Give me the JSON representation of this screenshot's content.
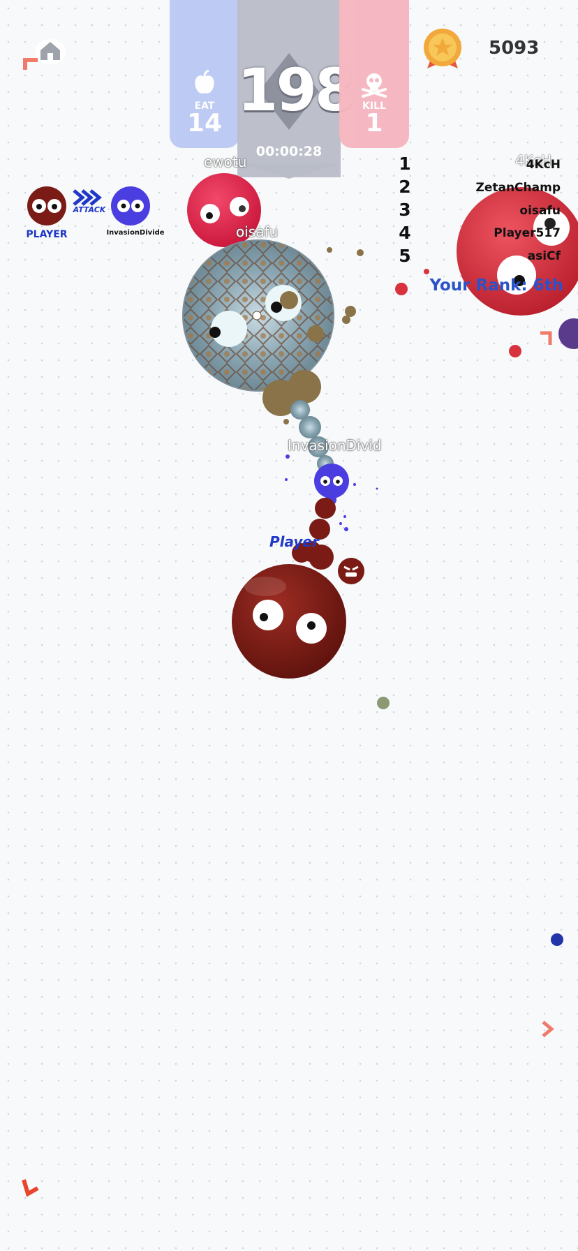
{
  "hud": {
    "eat_label": "EAT",
    "eat_count": "14",
    "score": "198",
    "timer": "00:00:28",
    "kill_label": "KILL",
    "kill_count": "1"
  },
  "coins": {
    "amount": "5093",
    "icon": "gold-medal-icon"
  },
  "home_button": {
    "icon": "home-icon"
  },
  "attack_indicator": {
    "attacker": "PLAYER",
    "action": "ATTACK",
    "target": "InvasionDivide"
  },
  "leaderboard": {
    "entries": [
      {
        "rank": "1",
        "name": "4KcH"
      },
      {
        "rank": "2",
        "name": "ZetanChamp"
      },
      {
        "rank": "3",
        "name": "oisafu"
      },
      {
        "rank": "4",
        "name": "Player517"
      },
      {
        "rank": "5",
        "name": "asiCf"
      }
    ],
    "your_rank": "Your Rank: 6th"
  },
  "players": {
    "ewotu": "ewotu",
    "oisafu": "oisafu",
    "invasion": "InvasionDivid",
    "player": "Player",
    "offscreen": "4KcH"
  },
  "colors": {
    "player": "#7a1c15",
    "invasion": "#4a3ee0",
    "ewotu": "#e2234a",
    "leader": "#d9323f",
    "food_brown": "#8a7348",
    "rank_blue": "#2a52c9"
  }
}
